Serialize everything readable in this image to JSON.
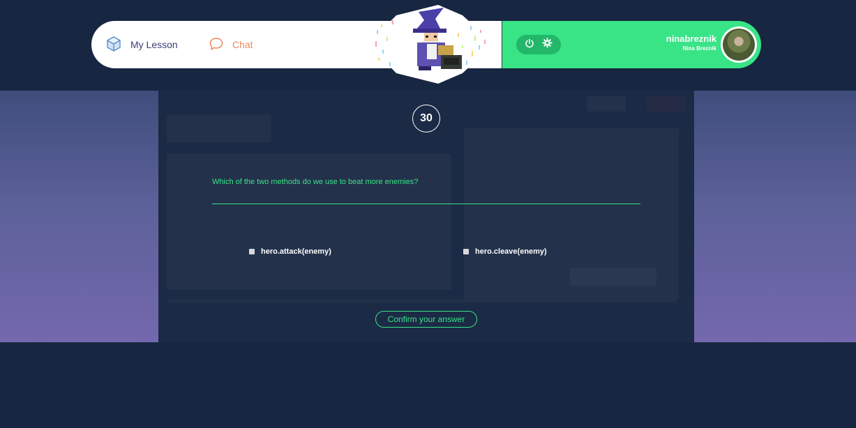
{
  "nav": {
    "my_lesson_label": "My Lesson",
    "chat_label": "Chat",
    "user": {
      "username": "ninabreznik",
      "full_name": "Nina Breznik"
    },
    "icons": {
      "lesson": "cube-icon",
      "chat": "chat-bubble-icon",
      "power": "power-icon",
      "settings": "gear-icon"
    }
  },
  "quiz": {
    "timer": "30",
    "question": "Which of the two methods do we use to beat more enemies?",
    "options": [
      {
        "label": "hero.attack(enemy)"
      },
      {
        "label": "hero.cleave(enemy)"
      }
    ],
    "confirm_label": "Confirm your answer"
  },
  "colors": {
    "background": "#172641",
    "accent_green": "#38e486",
    "lesson_text": "#3a3f78",
    "chat_text": "#f08a5d",
    "panel": "#1b2a45"
  }
}
